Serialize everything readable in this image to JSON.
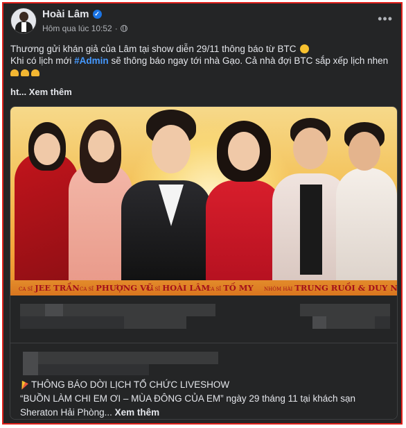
{
  "post": {
    "author": "Hoài Lâm",
    "timestamp": "Hôm qua lúc 10:52",
    "separator": "·",
    "more_menu": "•••",
    "line1": "Thương gửi khán giả của Lâm tại show diễn 29/11 thông báo từ BTC",
    "line2_a": "Khi có lịch mới",
    "hashtag": "#Admin",
    "line2_b": "sẽ thông báo ngay tới nhà Gạo. Cả nhà đợi BTC sắp xếp lịch nhen",
    "see_more": "ht... Xem thêm"
  },
  "banner": {
    "captions": [
      {
        "prefix": "CA SĨ",
        "name": "JEE TRẦN"
      },
      {
        "prefix": "CA SĨ",
        "name": "PHƯỢNG VŨ"
      },
      {
        "prefix": "CA SĨ",
        "name": "HOÀI LÂM"
      },
      {
        "prefix": "CA SĨ",
        "name": "TỐ MY"
      },
      {
        "prefix": "NHÓM HÀI",
        "name": "TRUNG RUỒI & DUY NAM"
      }
    ]
  },
  "shared": {
    "notice_line1": "THÔNG BÁO DỜI LỊCH TỔ CHỨC LIVESHOW",
    "notice_line2": "“BUỒN LÀM CHI EM ƠI – MÙA ĐÔNG CỦA EM” ngày 29 tháng 11 tại khách sạn",
    "notice_line3": "Sheraton Hải Phòng...",
    "see_more": "Xem thêm"
  },
  "colors": {
    "background": "#242526",
    "text": "#e4e6eb",
    "secondary_text": "#b0b3b8",
    "hashtag": "#4599ff",
    "verified": "#1b74e4",
    "frame_border": "#e0201a"
  },
  "icons": [
    "verified-icon",
    "globe-icon",
    "more-icon",
    "emoji-icon",
    "hands-icon",
    "party-icon"
  ]
}
